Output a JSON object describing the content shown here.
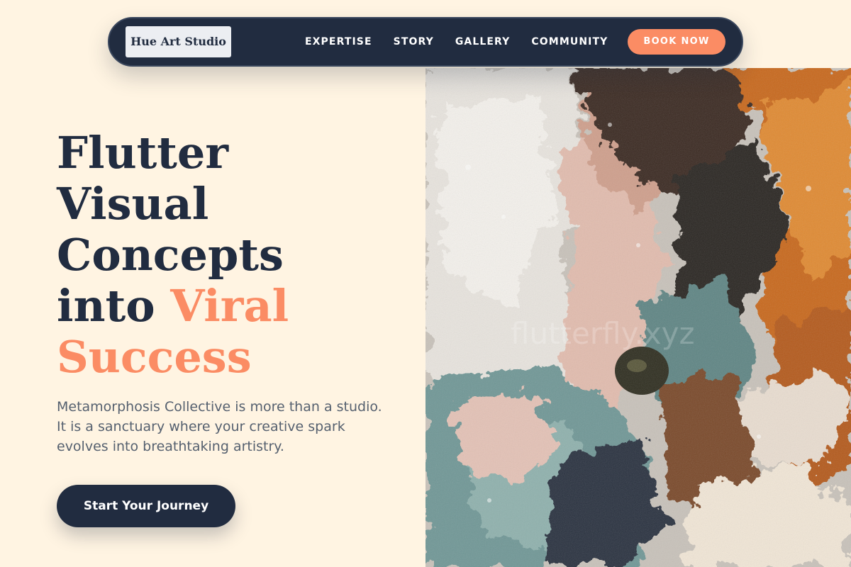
{
  "nav": {
    "logo": "Hue Art Studio",
    "links": [
      "EXPERTISE",
      "STORY",
      "GALLERY",
      "COMMUNITY"
    ],
    "cta": "BOOK NOW"
  },
  "hero": {
    "headline_lines": [
      "Flutter",
      "Visual",
      "Concepts",
      "into "
    ],
    "headline_accent_inline": "Viral",
    "headline_accent_line": "Success",
    "subtitle": "Metamorphosis Collective is more than a studio. It is a sanctuary where your creative spark evolves into breathtaking artistry.",
    "cta": "Start Your Journey"
  },
  "artwork": {
    "watermark": "flutterfly.xyz"
  },
  "colors": {
    "background": "#fff4e2",
    "navy": "#212c40",
    "accent": "#fb8c64",
    "body_text": "#55606f"
  }
}
